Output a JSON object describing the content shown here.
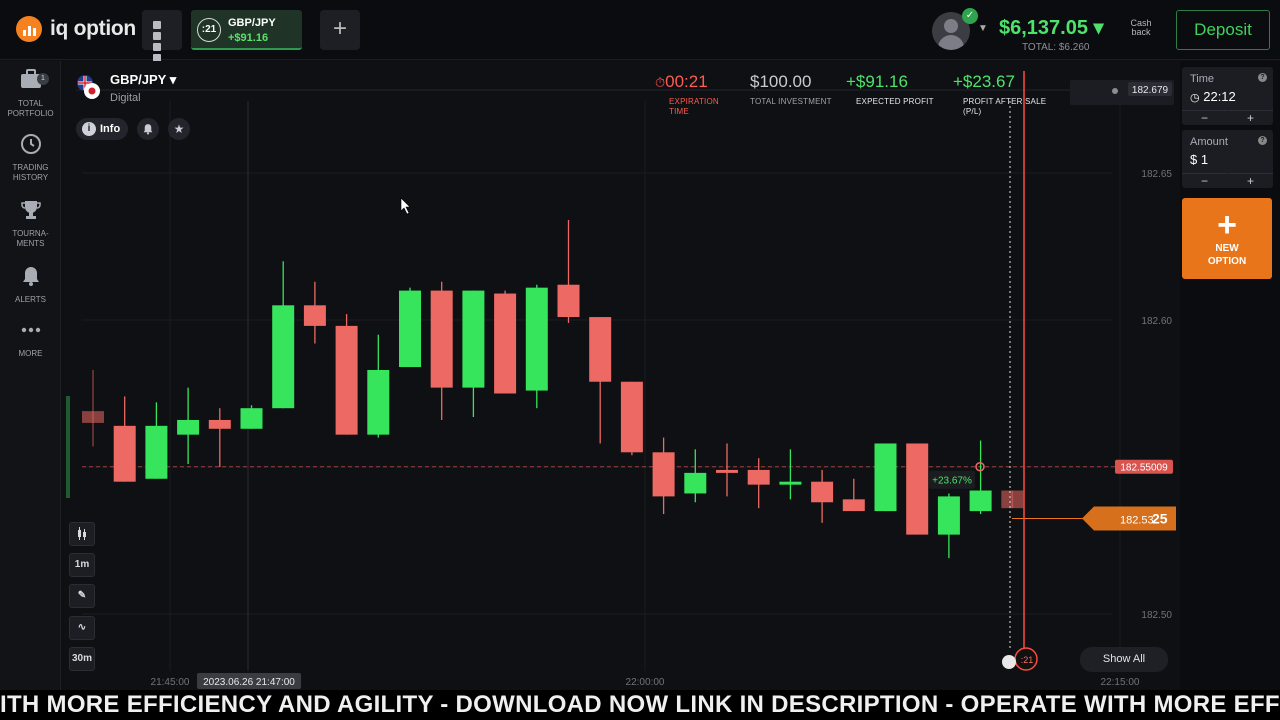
{
  "header": {
    "logo_text": "iq option",
    "active_asset_tab": {
      "timer": ":21",
      "name": "GBP/JPY",
      "pnl": "+$91.16"
    },
    "balance": "$6,137.05 ▾",
    "balance_total": "TOTAL: $6,260",
    "cashback_label_1": "Cash",
    "cashback_label_2": "back",
    "deposit_label": "Deposit",
    "colors": {
      "green": "#4de36b",
      "orange": "#e8751a"
    }
  },
  "sidebar": {
    "items": [
      {
        "line1": "TOTAL",
        "line2": "PORTFOLIO",
        "icon": "briefcase-icon",
        "badge": "1"
      },
      {
        "line1": "TRADING",
        "line2": "HISTORY",
        "icon": "clock-icon"
      },
      {
        "line1": "TOURNA-",
        "line2": "MENTS",
        "icon": "trophy-icon"
      },
      {
        "line1": "ALERTS",
        "line2": "",
        "icon": "bell-icon"
      },
      {
        "line1": "MORE",
        "line2": "",
        "icon": "dots-icon"
      }
    ]
  },
  "asset": {
    "name": "GBP/JPY ▾",
    "type": "Digital",
    "info_label": "Info"
  },
  "stats": {
    "expiration": {
      "value": "00:21",
      "label_1": "EXPIRATION",
      "label_2": "TIME"
    },
    "investment": {
      "value": "$100.00",
      "label": "TOTAL INVESTMENT"
    },
    "expected": {
      "value": "+$91.16",
      "label": "EXPECTED PROFIT"
    },
    "after_sale": {
      "value": "+$23.67",
      "label_1": "PROFIT AFTER SALE",
      "label_2": "(P/L)"
    }
  },
  "right_panel": {
    "time": {
      "label": "Time",
      "value": "22:12",
      "minus": "−",
      "plus": "+"
    },
    "amount": {
      "label": "Amount",
      "value": "$ 1",
      "minus": "−",
      "plus": "+"
    },
    "new_option_1": "NEW",
    "new_option_2": "OPTION"
  },
  "tools": {
    "timeframe": "1m",
    "zoom": "30m"
  },
  "chart_data": {
    "type": "candlestick",
    "y_ticks": [
      "182.65",
      "182.60",
      "182.55",
      "182.50"
    ],
    "top_price_label": "182.679",
    "strike_price": "182.55009",
    "current_price_main": "182.53",
    "current_price_tail": "25",
    "profit_marker": "+23.67%",
    "countdown": ":21",
    "x_ticks": [
      "21:45:00",
      "22:00:00",
      "22:15:00"
    ],
    "cursor_time": "2023.06.26 21:47:00",
    "candles": [
      {
        "o": 182.569,
        "h": 182.583,
        "l": 182.557,
        "c": 182.565,
        "dir": "down",
        "faded": true
      },
      {
        "o": 182.564,
        "h": 182.574,
        "l": 182.545,
        "c": 182.545,
        "dir": "down"
      },
      {
        "o": 182.546,
        "h": 182.572,
        "l": 182.546,
        "c": 182.564,
        "dir": "up"
      },
      {
        "o": 182.561,
        "h": 182.577,
        "l": 182.551,
        "c": 182.566,
        "dir": "up"
      },
      {
        "o": 182.566,
        "h": 182.57,
        "l": 182.55,
        "c": 182.563,
        "dir": "down"
      },
      {
        "o": 182.563,
        "h": 182.571,
        "l": 182.563,
        "c": 182.57,
        "dir": "up"
      },
      {
        "o": 182.57,
        "h": 182.62,
        "l": 182.57,
        "c": 182.605,
        "dir": "up"
      },
      {
        "o": 182.605,
        "h": 182.613,
        "l": 182.592,
        "c": 182.598,
        "dir": "down"
      },
      {
        "o": 182.598,
        "h": 182.602,
        "l": 182.561,
        "c": 182.561,
        "dir": "down"
      },
      {
        "o": 182.561,
        "h": 182.595,
        "l": 182.56,
        "c": 182.583,
        "dir": "up"
      },
      {
        "o": 182.584,
        "h": 182.611,
        "l": 182.584,
        "c": 182.61,
        "dir": "up"
      },
      {
        "o": 182.61,
        "h": 182.613,
        "l": 182.566,
        "c": 182.577,
        "dir": "down"
      },
      {
        "o": 182.577,
        "h": 182.61,
        "l": 182.567,
        "c": 182.61,
        "dir": "up"
      },
      {
        "o": 182.609,
        "h": 182.61,
        "l": 182.575,
        "c": 182.575,
        "dir": "down"
      },
      {
        "o": 182.576,
        "h": 182.612,
        "l": 182.57,
        "c": 182.611,
        "dir": "up"
      },
      {
        "o": 182.612,
        "h": 182.634,
        "l": 182.599,
        "c": 182.601,
        "dir": "down"
      },
      {
        "o": 182.601,
        "h": 182.601,
        "l": 182.558,
        "c": 182.579,
        "dir": "down"
      },
      {
        "o": 182.579,
        "h": 182.579,
        "l": 182.554,
        "c": 182.555,
        "dir": "down"
      },
      {
        "o": 182.555,
        "h": 182.56,
        "l": 182.534,
        "c": 182.54,
        "dir": "down"
      },
      {
        "o": 182.541,
        "h": 182.556,
        "l": 182.538,
        "c": 182.548,
        "dir": "up"
      },
      {
        "o": 182.549,
        "h": 182.558,
        "l": 182.54,
        "c": 182.548,
        "dir": "down"
      },
      {
        "o": 182.549,
        "h": 182.553,
        "l": 182.536,
        "c": 182.544,
        "dir": "down"
      },
      {
        "o": 182.544,
        "h": 182.556,
        "l": 182.539,
        "c": 182.545,
        "dir": "up"
      },
      {
        "o": 182.545,
        "h": 182.549,
        "l": 182.531,
        "c": 182.538,
        "dir": "down"
      },
      {
        "o": 182.539,
        "h": 182.546,
        "l": 182.535,
        "c": 182.535,
        "dir": "down"
      },
      {
        "o": 182.535,
        "h": 182.558,
        "l": 182.535,
        "c": 182.558,
        "dir": "up"
      },
      {
        "o": 182.558,
        "h": 182.558,
        "l": 182.527,
        "c": 182.527,
        "dir": "down"
      },
      {
        "o": 182.527,
        "h": 182.541,
        "l": 182.519,
        "c": 182.54,
        "dir": "up"
      },
      {
        "o": 182.535,
        "h": 182.559,
        "l": 182.534,
        "c": 182.542,
        "dir": "up"
      },
      {
        "o": 182.542,
        "h": 182.542,
        "l": 182.536,
        "c": 182.536,
        "dir": "down",
        "faded": true
      }
    ]
  },
  "ticker_text": "ITH MORE EFFICIENCY AND AGILITY - DOWNLOAD NOW LINK IN DESCRIPTION - OPERATE WITH MORE EFFICIENCY AND AGILITY"
}
